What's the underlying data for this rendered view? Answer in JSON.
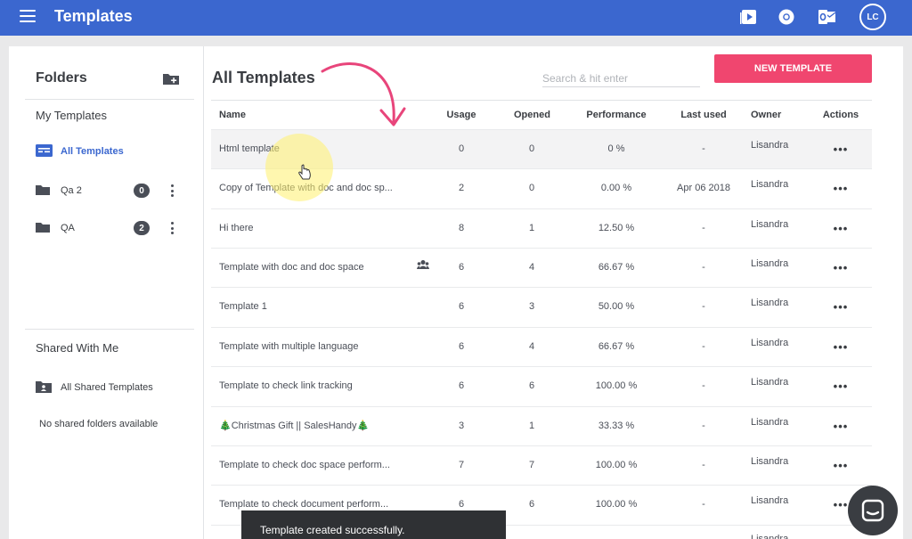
{
  "header": {
    "title": "Templates",
    "avatar_initials": "LC"
  },
  "sidebar": {
    "folders_title": "Folders",
    "my_templates": "My Templates",
    "all_templates": "All Templates",
    "folders": [
      {
        "name": "Qa 2",
        "count": "0"
      },
      {
        "name": "QA",
        "count": "2"
      }
    ],
    "shared_title": "Shared With Me",
    "all_shared": "All Shared Templates",
    "no_shared": "No shared folders available"
  },
  "main": {
    "title": "All Templates",
    "search_placeholder": "Search & hit enter",
    "new_button": "NEW TEMPLATE",
    "columns": [
      "Name",
      "Usage",
      "Opened",
      "Performance",
      "Last used",
      "Owner",
      "Actions"
    ],
    "rows": [
      {
        "name": "Html template",
        "usage": "0",
        "opened": "0",
        "performance": "0 %",
        "last_used": "-",
        "owner": "Lisandra",
        "actions": "•••"
      },
      {
        "name": "Copy of Template with doc and doc sp...",
        "usage": "2",
        "opened": "0",
        "performance": "0.00 %",
        "last_used": "Apr 06 2018",
        "owner": "Lisandra",
        "actions": "•••"
      },
      {
        "name": "Hi there",
        "usage": "8",
        "opened": "1",
        "performance": "12.50 %",
        "last_used": "-",
        "owner": "Lisandra",
        "actions": "•••"
      },
      {
        "name": "Template with doc and doc space",
        "usage": "6",
        "opened": "4",
        "performance": "66.67 %",
        "last_used": "-",
        "owner": "Lisandra",
        "actions": "•••"
      },
      {
        "name": "Template 1",
        "usage": "6",
        "opened": "3",
        "performance": "50.00 %",
        "last_used": "-",
        "owner": "Lisandra",
        "actions": "•••"
      },
      {
        "name": "Template with multiple language",
        "usage": "6",
        "opened": "4",
        "performance": "66.67 %",
        "last_used": "-",
        "owner": "Lisandra",
        "actions": "•••"
      },
      {
        "name": "Template to check link tracking",
        "usage": "6",
        "opened": "6",
        "performance": "100.00 %",
        "last_used": "-",
        "owner": "Lisandra",
        "actions": "•••"
      },
      {
        "name": "🎄Christmas Gift || SalesHandy🎄",
        "usage": "3",
        "opened": "1",
        "performance": "33.33 %",
        "last_used": "-",
        "owner": "Lisandra",
        "actions": "•••"
      },
      {
        "name": "Template to check doc space perform...",
        "usage": "7",
        "opened": "7",
        "performance": "100.00 %",
        "last_used": "-",
        "owner": "Lisandra",
        "actions": "•••"
      },
      {
        "name": "Template to check document perform...",
        "usage": "6",
        "opened": "6",
        "performance": "100.00 %",
        "last_used": "-",
        "owner": "Lisandra",
        "actions": "•••"
      },
      {
        "name": "",
        "usage": "",
        "opened": "",
        "performance": "",
        "last_used": "",
        "owner": "Lisandra",
        "actions": ""
      }
    ]
  },
  "toast": {
    "message": "Template created successfully."
  },
  "colors": {
    "header": "#3b67cf",
    "accent": "#f0466f",
    "active_link": "#3b67cf"
  }
}
